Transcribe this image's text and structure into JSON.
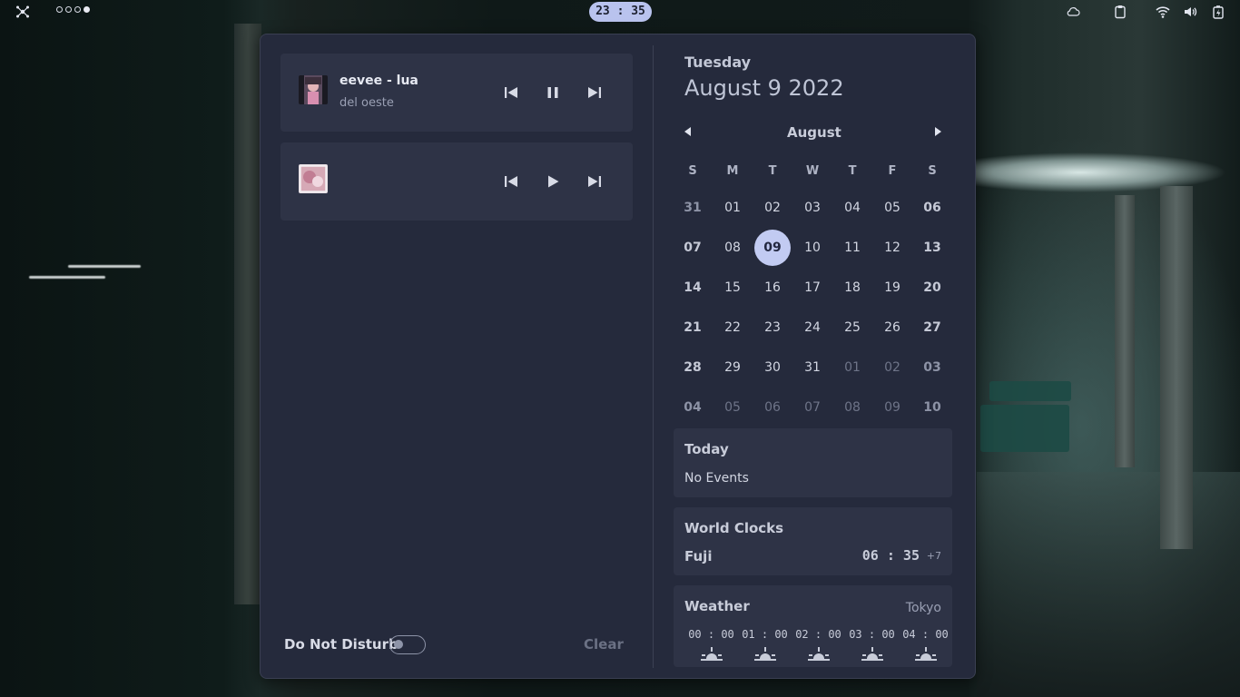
{
  "topbar": {
    "clock": "23 : 35",
    "workspaces": [
      {
        "active": false
      },
      {
        "active": false
      },
      {
        "active": false
      },
      {
        "active": true
      }
    ],
    "tray_icons": [
      "cloud-icon",
      "clipboard-icon",
      "wifi-icon",
      "volume-icon",
      "battery-icon"
    ]
  },
  "players": [
    {
      "title": "eevee - lua",
      "artist": "del oeste",
      "state": "playing"
    },
    {
      "title": "",
      "artist": "",
      "state": "paused"
    }
  ],
  "notifications": {
    "dnd_label": "Do Not Disturb",
    "dnd_enabled": false,
    "clear_label": "Clear"
  },
  "date": {
    "weekday": "Tuesday",
    "full": "August 9 2022"
  },
  "calendar": {
    "month": "August",
    "weekdays": [
      "S",
      "M",
      "T",
      "W",
      "T",
      "F",
      "S"
    ],
    "weeks": [
      [
        {
          "d": "31",
          "m": true
        },
        {
          "d": "01"
        },
        {
          "d": "02"
        },
        {
          "d": "03"
        },
        {
          "d": "04"
        },
        {
          "d": "05"
        },
        {
          "d": "06"
        }
      ],
      [
        {
          "d": "07"
        },
        {
          "d": "08"
        },
        {
          "d": "09",
          "today": true
        },
        {
          "d": "10"
        },
        {
          "d": "11"
        },
        {
          "d": "12"
        },
        {
          "d": "13"
        }
      ],
      [
        {
          "d": "14"
        },
        {
          "d": "15"
        },
        {
          "d": "16"
        },
        {
          "d": "17"
        },
        {
          "d": "18"
        },
        {
          "d": "19"
        },
        {
          "d": "20"
        }
      ],
      [
        {
          "d": "21"
        },
        {
          "d": "22"
        },
        {
          "d": "23"
        },
        {
          "d": "24"
        },
        {
          "d": "25"
        },
        {
          "d": "26"
        },
        {
          "d": "27"
        }
      ],
      [
        {
          "d": "28"
        },
        {
          "d": "29"
        },
        {
          "d": "30"
        },
        {
          "d": "31"
        },
        {
          "d": "01",
          "m": true
        },
        {
          "d": "02",
          "m": true
        },
        {
          "d": "03",
          "m": true
        }
      ],
      [
        {
          "d": "04",
          "m": true
        },
        {
          "d": "05",
          "m": true
        },
        {
          "d": "06",
          "m": true
        },
        {
          "d": "07",
          "m": true
        },
        {
          "d": "08",
          "m": true
        },
        {
          "d": "09",
          "m": true
        },
        {
          "d": "10",
          "m": true
        }
      ]
    ]
  },
  "events": {
    "title": "Today",
    "empty_text": "No Events"
  },
  "world_clocks": {
    "title": "World Clocks",
    "entries": [
      {
        "city": "Fuji",
        "time": "06 : 35",
        "offset": "+7"
      }
    ]
  },
  "weather": {
    "title": "Weather",
    "location": "Tokyo",
    "forecast": [
      {
        "time": "00 : 00",
        "icon": "night-icon"
      },
      {
        "time": "01 : 00",
        "icon": "night-icon"
      },
      {
        "time": "02 : 00",
        "icon": "night-icon"
      },
      {
        "time": "03 : 00",
        "icon": "night-icon"
      },
      {
        "time": "04 : 00",
        "icon": "night-icon"
      }
    ]
  },
  "colors": {
    "panel_bg": "#252a3c",
    "card_bg": "#2e3346",
    "accent": "#c2cbf2"
  }
}
